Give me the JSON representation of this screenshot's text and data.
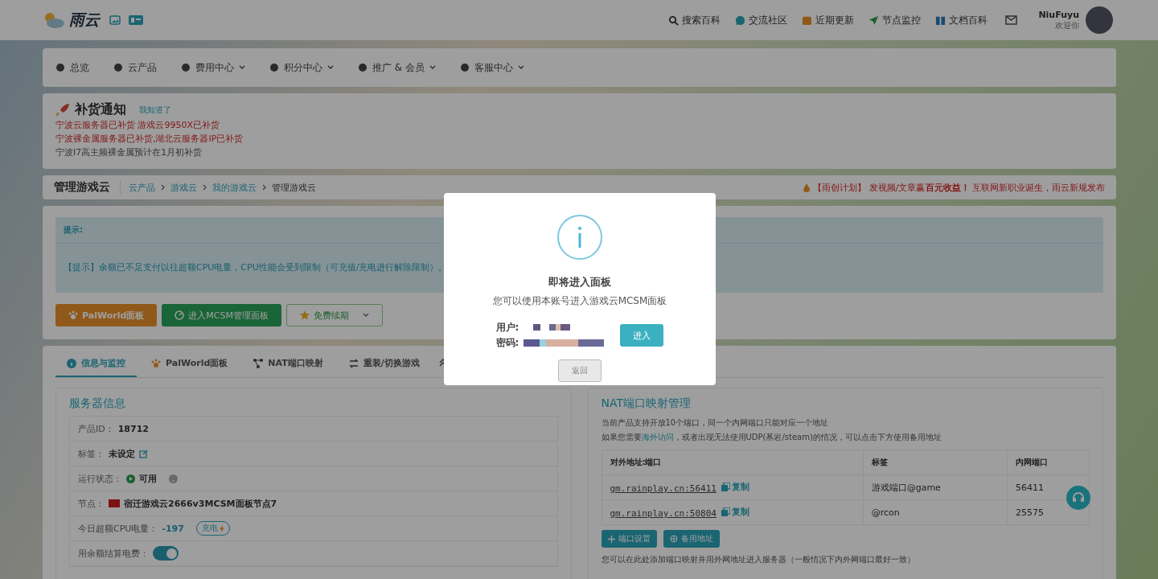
{
  "header": {
    "logo": "雨云",
    "links": [
      {
        "label": "搜索百科"
      },
      {
        "label": "交流社区"
      },
      {
        "label": "近期更新"
      },
      {
        "label": "节点监控"
      },
      {
        "label": "文档百科"
      }
    ],
    "user": {
      "name": "NiuFuyu",
      "greeting": "欢迎你"
    }
  },
  "menu": [
    {
      "label": "总览",
      "dropdown": false
    },
    {
      "label": "云产品",
      "dropdown": false
    },
    {
      "label": "费用中心",
      "dropdown": true
    },
    {
      "label": "积分中心",
      "dropdown": true
    },
    {
      "label": "推广 & 会员",
      "dropdown": true
    },
    {
      "label": "客服中心",
      "dropdown": true
    }
  ],
  "restock": {
    "title": "补货通知",
    "dismiss": "我知道了",
    "lines": [
      {
        "text": "宁波云服务器已补货 游戏云9950X已补货",
        "highlighted": true
      },
      {
        "text": "宁波裸金属服务器已补货,湖北云服务器IP已补货",
        "highlighted": true
      },
      {
        "text": "宁波I7高主频裸金属预计在1月初补货",
        "highlighted": false
      }
    ]
  },
  "breadcrumb": {
    "title": "管理游戏云",
    "path": [
      "云产品",
      "游戏云",
      "我的游戏云",
      "管理游戏云"
    ],
    "promo": "【雨创计划】 发视频/文章赢**百元收益！** 互联网新职业诞生，雨云新规发布"
  },
  "alert": {
    "heading": "提示:",
    "message": "【提示】余额已不足支付以往超额CPU电量，CPU性能会受到限制（可充值/充电进行解除限制）。"
  },
  "actions": [
    {
      "label": "PalWorld面板",
      "kind": "palworld"
    },
    {
      "label": "进入MCSM管理面板",
      "kind": "mcsm"
    },
    {
      "label": "免费续期",
      "kind": "renew"
    }
  ],
  "tabs": [
    {
      "label": "信息与监控",
      "selected": true
    },
    {
      "label": "PalWorld面板",
      "selected": false
    },
    {
      "label": "NAT端口映射",
      "selected": false
    },
    {
      "label": "重装/切换游戏",
      "selected": false
    }
  ],
  "server_info": {
    "title": "服务器信息",
    "rows": [
      {
        "kind": "text",
        "label": "产品ID：",
        "value": "18712"
      },
      {
        "kind": "edit",
        "label": "标签：",
        "value": "未设定"
      },
      {
        "kind": "status",
        "label": "运行状态：",
        "value": "可用"
      },
      {
        "kind": "flag",
        "label": "节点：",
        "value": "宿迁游戏云2666v3MCSM面板节点7"
      },
      {
        "kind": "cpu",
        "label": "今日超额CPU电量：",
        "value": "-197",
        "button": "充电"
      },
      {
        "kind": "toggle",
        "label": "用余额结算电费：",
        "on": true
      }
    ]
  },
  "nat": {
    "title": "NAT端口映射管理",
    "line1": "当前产品支持开放10个端口，同一个内网端口只能对应一个地址",
    "line2_before": "如果您需要",
    "line2_link": "海外访问",
    "line2_after": "，或者出现无法使用UDP(基岩/steam)的情况，可以点击下方使用备用地址",
    "columns": [
      "对外地址:端口",
      "标签",
      "内网端口"
    ],
    "rows": [
      {
        "address": "gm.rainplay.cn:56411",
        "copy": "复制",
        "tag": "游戏端口@game",
        "port": "56411"
      },
      {
        "address": "gm.rainplay.cn:50804",
        "copy": "复制",
        "tag": "@rcon",
        "port": "25575"
      }
    ],
    "buttons": [
      "端口设置",
      "备用地址"
    ],
    "note": "您可以在此处添加端口映射并用外网地址进入服务器（一般情况下内外网端口最好一致）"
  },
  "modal": {
    "title": "即将进入面板",
    "message": "您可以使用本账号进入游戏云MCSM面板",
    "user_label": "用户:",
    "pass_label": "密码:",
    "enter": "进入",
    "back": "返回"
  }
}
